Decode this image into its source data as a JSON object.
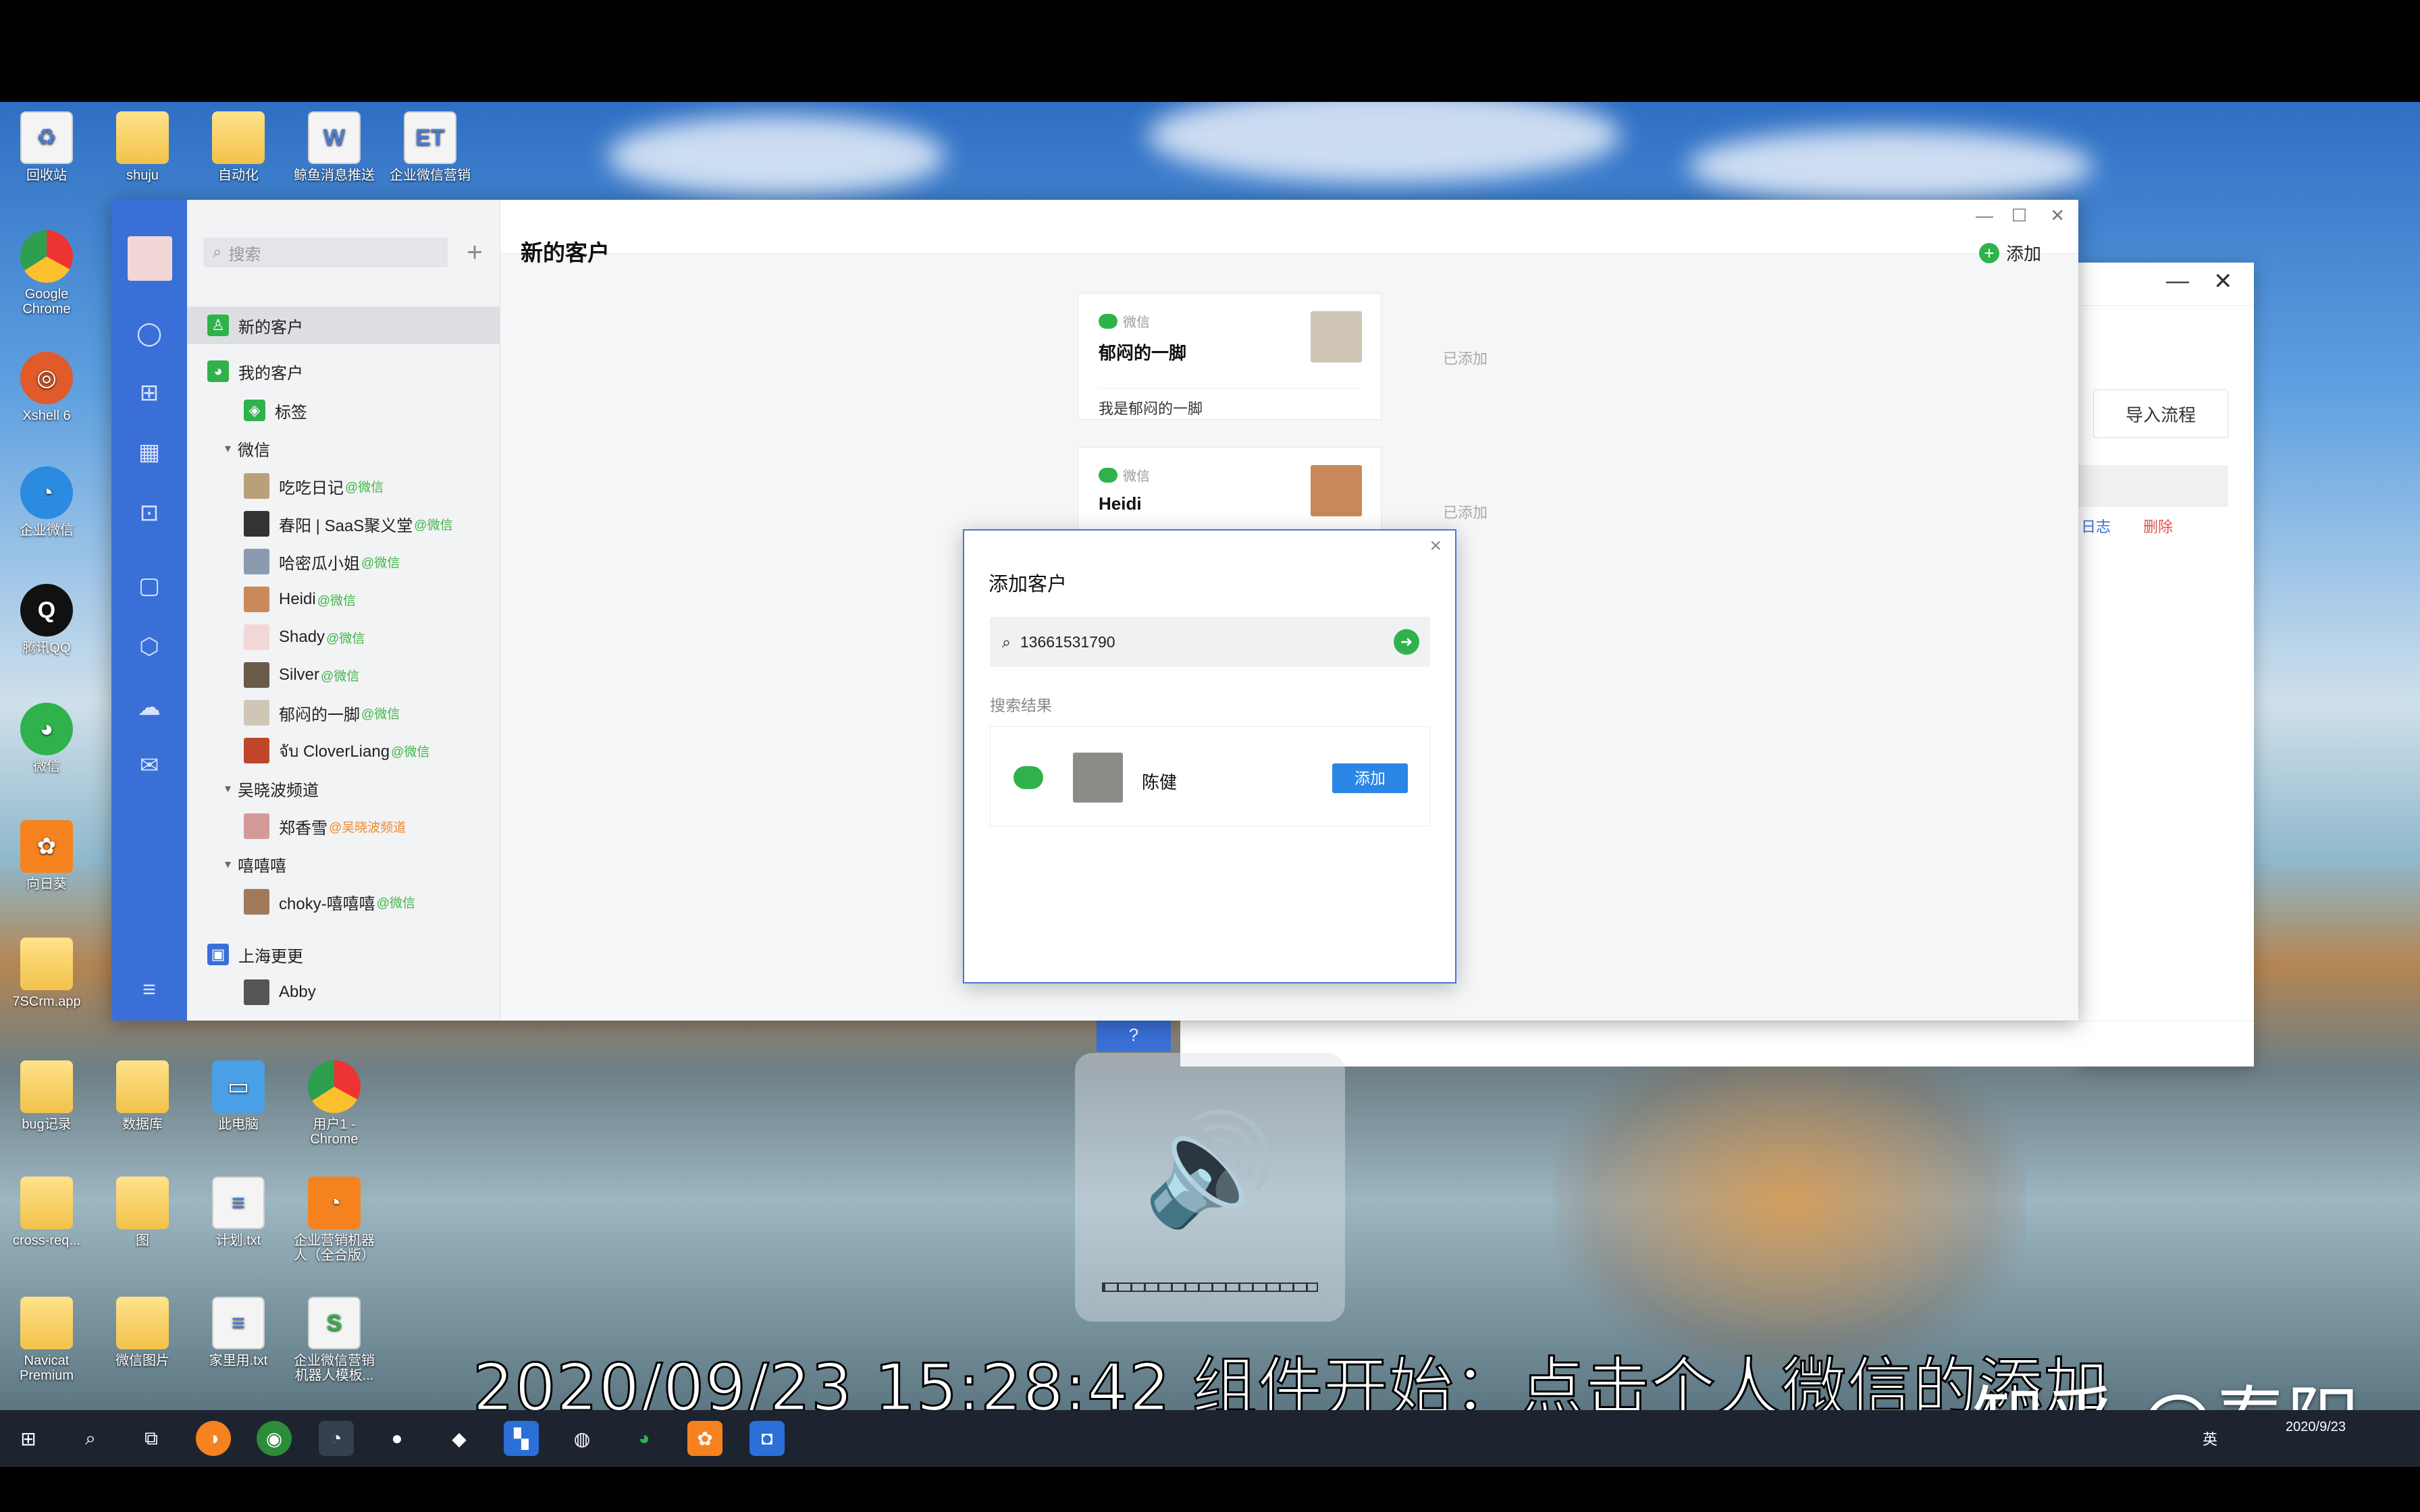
{
  "desktop": {
    "icons_top": [
      {
        "label": "回收站",
        "glyph": "♻"
      },
      {
        "label": "shuju",
        "glyph": ""
      },
      {
        "label": "自动化",
        "glyph": ""
      },
      {
        "label": "鲸鱼消息推送",
        "glyph": "W"
      },
      {
        "label": "企业微信营销",
        "glyph": "ET"
      }
    ],
    "icons_left": [
      {
        "label": "Google Chrome",
        "glyph": "●"
      },
      {
        "label": "Xshell 6",
        "glyph": "◎"
      },
      {
        "label": "企业微信",
        "glyph": "◔"
      },
      {
        "label": "腾讯QQ",
        "glyph": "Q"
      },
      {
        "label": "微信",
        "glyph": "◕"
      },
      {
        "label": "向日葵",
        "glyph": "✿"
      },
      {
        "label": "7SCrm.app",
        "glyph": ""
      }
    ],
    "icons_bottom": [
      {
        "label": "bug记录",
        "glyph": ""
      },
      {
        "label": "数据库",
        "glyph": ""
      },
      {
        "label": "此电脑",
        "glyph": "▭"
      },
      {
        "label": "用户1 - Chrome",
        "glyph": "●"
      },
      {
        "label": "cross-req...",
        "glyph": ""
      },
      {
        "label": "图",
        "glyph": ""
      },
      {
        "label": "计划.txt",
        "glyph": "≡"
      },
      {
        "label": "企业营销机器人（全合版）",
        "glyph": "◔"
      },
      {
        "label": "Navicat Premium",
        "glyph": ""
      },
      {
        "label": "微信图片",
        "glyph": ""
      },
      {
        "label": "家里用.txt",
        "glyph": "≡"
      },
      {
        "label": "企业微信营销机器人模板...",
        "glyph": "S"
      }
    ]
  },
  "app": {
    "search_placeholder": "搜索",
    "content_title": "新的客户",
    "add_label": "添加",
    "sidebar": {
      "new_customers": "新的客户",
      "my_customers": "我的客户",
      "tags": "标签",
      "group_wechat": "微信",
      "wechat_contacts": [
        {
          "name": "吃吃日记",
          "tag": "@微信"
        },
        {
          "name": "春阳 | SaaS聚义堂",
          "tag": "@微信"
        },
        {
          "name": "哈密瓜小姐",
          "tag": "@微信"
        },
        {
          "name": "Heidi",
          "tag": "@微信"
        },
        {
          "name": "Shady",
          "tag": "@微信"
        },
        {
          "name": "Silver",
          "tag": "@微信"
        },
        {
          "name": "郁闷的一脚",
          "tag": "@微信"
        },
        {
          "name": "จับ CloverLiang",
          "tag": "@微信"
        }
      ],
      "group_wu": "吴晓波频道",
      "wu_contacts": [
        {
          "name": "郑香雪",
          "tag": "@吴晓波频道"
        }
      ],
      "group_xi": "嘻嘻嘻",
      "xi_contacts": [
        {
          "name": "choky-嘻嘻嘻",
          "tag": "@微信"
        }
      ],
      "group_shanghai": "上海更更",
      "shanghai_contacts": [
        {
          "name": "Abby",
          "tag": ""
        }
      ]
    },
    "cards": [
      {
        "source": "微信",
        "name": "郁闷的一脚",
        "message": "我是郁闷的一脚",
        "status": "已添加"
      },
      {
        "source": "微信",
        "name": "Heidi",
        "message": "",
        "status": "已添加"
      }
    ]
  },
  "second_window": {
    "import_label": "导入流程",
    "log_label": "日志",
    "delete_label": "删除",
    "help_label": "?"
  },
  "dialog": {
    "title": "添加客户",
    "search_value": "13661531790",
    "results_label": "搜索结果",
    "result_name": "陈健",
    "result_add": "添加"
  },
  "overlay": {
    "subtitle": "2020/09/23 15:28:42 组件开始：点击个人微信的添加",
    "watermark": "知乎 @春阳"
  },
  "taskbar": {
    "ime": "英",
    "time": "",
    "date": "2020/9/23"
  },
  "colors": {
    "brand_blue": "#3a6fd8",
    "wechat_green": "#2fb24b",
    "button_blue": "#2b86e6",
    "delete_red": "#e2524a"
  }
}
